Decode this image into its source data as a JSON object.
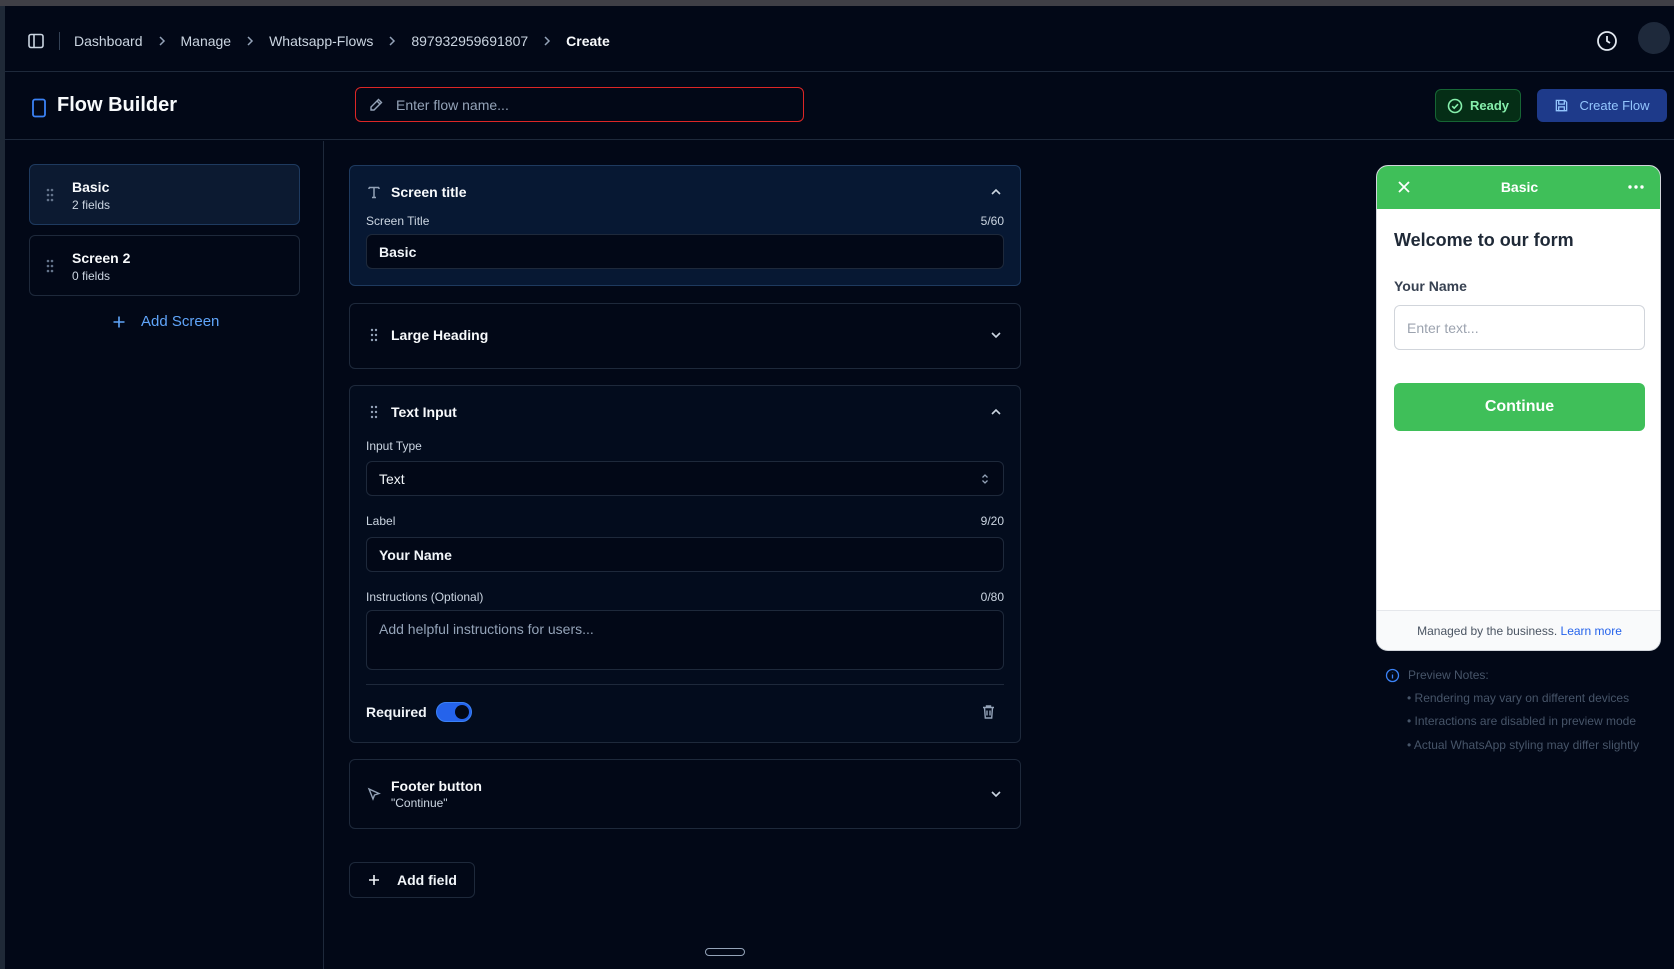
{
  "breadcrumb": {
    "items": [
      "Dashboard",
      "Manage",
      "Whatsapp-Flows",
      "897932959691807"
    ],
    "current": "Create"
  },
  "header": {
    "title": "Flow Builder",
    "flow_name_placeholder": "Enter flow name...",
    "flow_name_value": "",
    "ready_label": "Ready",
    "create_label": "Create Flow"
  },
  "sidebar": {
    "screens": [
      {
        "name": "Basic",
        "count": "2 fields"
      },
      {
        "name": "Screen 2",
        "count": "0 fields"
      }
    ],
    "add_screen_label": "Add Screen"
  },
  "editor": {
    "screen_title": {
      "header": "Screen title",
      "field_label": "Screen Title",
      "counter": "5/60",
      "value": "Basic"
    },
    "large_heading": {
      "header": "Large Heading"
    },
    "text_input": {
      "header": "Text Input",
      "input_type_label": "Input Type",
      "input_type_value": "Text",
      "label_label": "Label",
      "label_counter": "9/20",
      "label_value": "Your Name",
      "instructions_label": "Instructions (Optional)",
      "instructions_counter": "0/80",
      "instructions_placeholder": "Add helpful instructions for users...",
      "required_label": "Required",
      "required_on": true
    },
    "footer_button": {
      "header": "Footer button",
      "subtitle": "\"Continue\""
    },
    "add_field_label": "Add field"
  },
  "preview": {
    "title": "Basic",
    "heading": "Welcome to our form",
    "field_label": "Your Name",
    "field_placeholder": "Enter text...",
    "button_label": "Continue",
    "footer_text": "Managed by the business.",
    "footer_link": "Learn more",
    "notes_title": "Preview Notes:",
    "notes": [
      "• Rendering may vary on different devices",
      "• Interactions are disabled in preview mode",
      "• Actual WhatsApp styling may differ slightly"
    ]
  },
  "colors": {
    "background": "#020817",
    "accent": "#3b82f6",
    "whatsapp_green": "#3fbf59",
    "error_border": "#dc2626"
  }
}
